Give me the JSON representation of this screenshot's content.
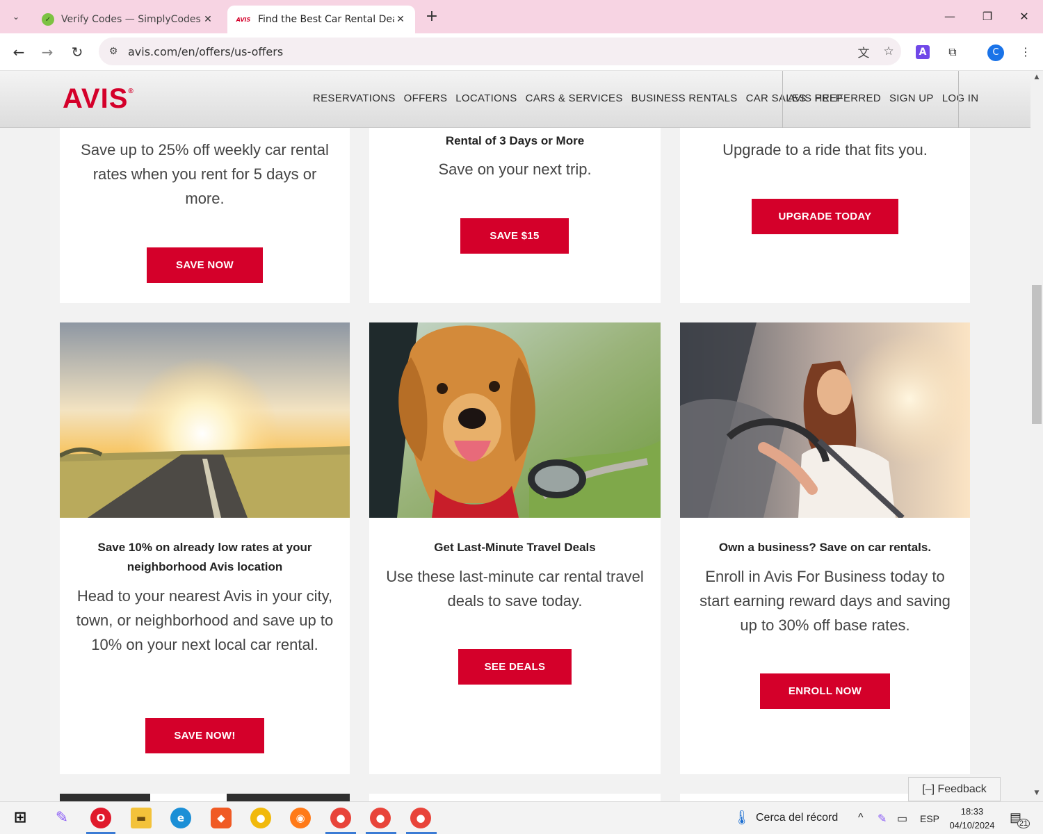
{
  "browser": {
    "tabs": [
      {
        "title": "Verify Codes — SimplyCodes",
        "favicon": "simplycodes-icon",
        "active": false
      },
      {
        "title": "Find the Best Car Rental Deals &",
        "favicon": "avis-icon",
        "favicon_text": "AVIS",
        "active": true
      }
    ],
    "new_tab_symbol": "+",
    "url": "avis.com/en/offers/us-offers",
    "profile_initial": "C",
    "extension_initial": "A"
  },
  "site": {
    "logo": "AVIS",
    "logo_mark": "®",
    "nav": [
      "RESERVATIONS",
      "OFFERS",
      "LOCATIONS",
      "CARS & SERVICES",
      "BUSINESS RENTALS",
      "CAR SALES",
      "HELP"
    ],
    "user_nav": [
      "AVIS PREFERRED",
      "SIGN UP",
      "LOG IN"
    ]
  },
  "top_cards": [
    {
      "heading": "",
      "body": "Save up to 25% off weekly car rental rates when you rent for 5 days or more.",
      "button": "SAVE NOW"
    },
    {
      "heading": "Rental of 3 Days or More",
      "body": "Save on your next trip.",
      "button": "SAVE $15"
    },
    {
      "heading": "",
      "body": "Upgrade to a ride that fits you.",
      "button": "UPGRADE TODAY"
    }
  ],
  "cards": [
    {
      "image": "sunset-road-photo",
      "heading": "Save 10% on already low rates at your neighborhood Avis location",
      "body": "Head to your nearest Avis in your city, town, or neighborhood and save up to 10% on your next local car rental.",
      "button": "SAVE NOW!"
    },
    {
      "image": "dog-in-car-window-photo",
      "heading": "Get Last-Minute Travel Deals",
      "body": "Use these last-minute car rental travel deals to save today.",
      "button": "SEE DEALS"
    },
    {
      "image": "woman-driving-photo",
      "heading": "Own a business? Save on car rentals.",
      "body": "Enroll in Avis For Business today to start earning reward days and saving up to 30% off base rates.",
      "button": "ENROLL NOW"
    }
  ],
  "feedback": "[–] Feedback",
  "taskbar": {
    "weather": "Cerca del récord",
    "language": "ESP",
    "time": "18:33",
    "date": "04/10/2024",
    "notifications": "21"
  },
  "colors": {
    "brand_red": "#d4002a",
    "tab_bar": "#f7d4e3"
  }
}
